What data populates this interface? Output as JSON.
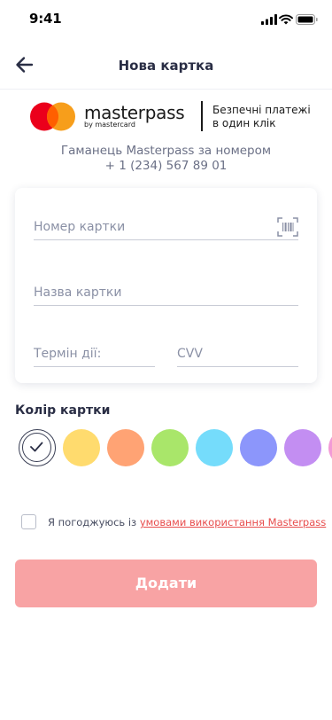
{
  "status_bar": {
    "time": "9:41"
  },
  "header": {
    "title": "Нова картка",
    "back_icon": "arrow-left-icon"
  },
  "masterpass": {
    "wordmark": "masterpass",
    "byline": "by mastercard",
    "tagline_line1": "Безпечні платежі",
    "tagline_line2": "в один клік",
    "brand_red": "#eb001b",
    "brand_orange": "#f79e1b"
  },
  "wallet": {
    "line1": "Гаманець Masterpass за номером",
    "line2": "+ 1 (234) 567 89 01"
  },
  "form": {
    "card_number": {
      "value": "",
      "placeholder": "Номер картки"
    },
    "card_name": {
      "value": "",
      "placeholder": "Назва картки"
    },
    "expiry": {
      "value": "",
      "placeholder": "Термін дії:"
    },
    "cvv": {
      "value": "",
      "placeholder": "CVV"
    },
    "scan_icon": "card-scan-icon"
  },
  "color_picker": {
    "label": "Колір картки",
    "selected_index": 0,
    "swatches": [
      "#ffffff",
      "#ffdb6e",
      "#ffa374",
      "#a9e66a",
      "#75dcfb",
      "#8c96fb",
      "#c38ef2",
      "#f29ad6"
    ]
  },
  "agreement": {
    "checked": false,
    "text": "Я погоджуюсь із ",
    "link_text": "умовами використання Masterpass"
  },
  "submit": {
    "label": "Додати",
    "color": "#f8a3a4"
  },
  "colors": {
    "accent_red": "#e84d4d",
    "text_dark": "#2a2e45",
    "text_muted": "#8a90a5"
  }
}
